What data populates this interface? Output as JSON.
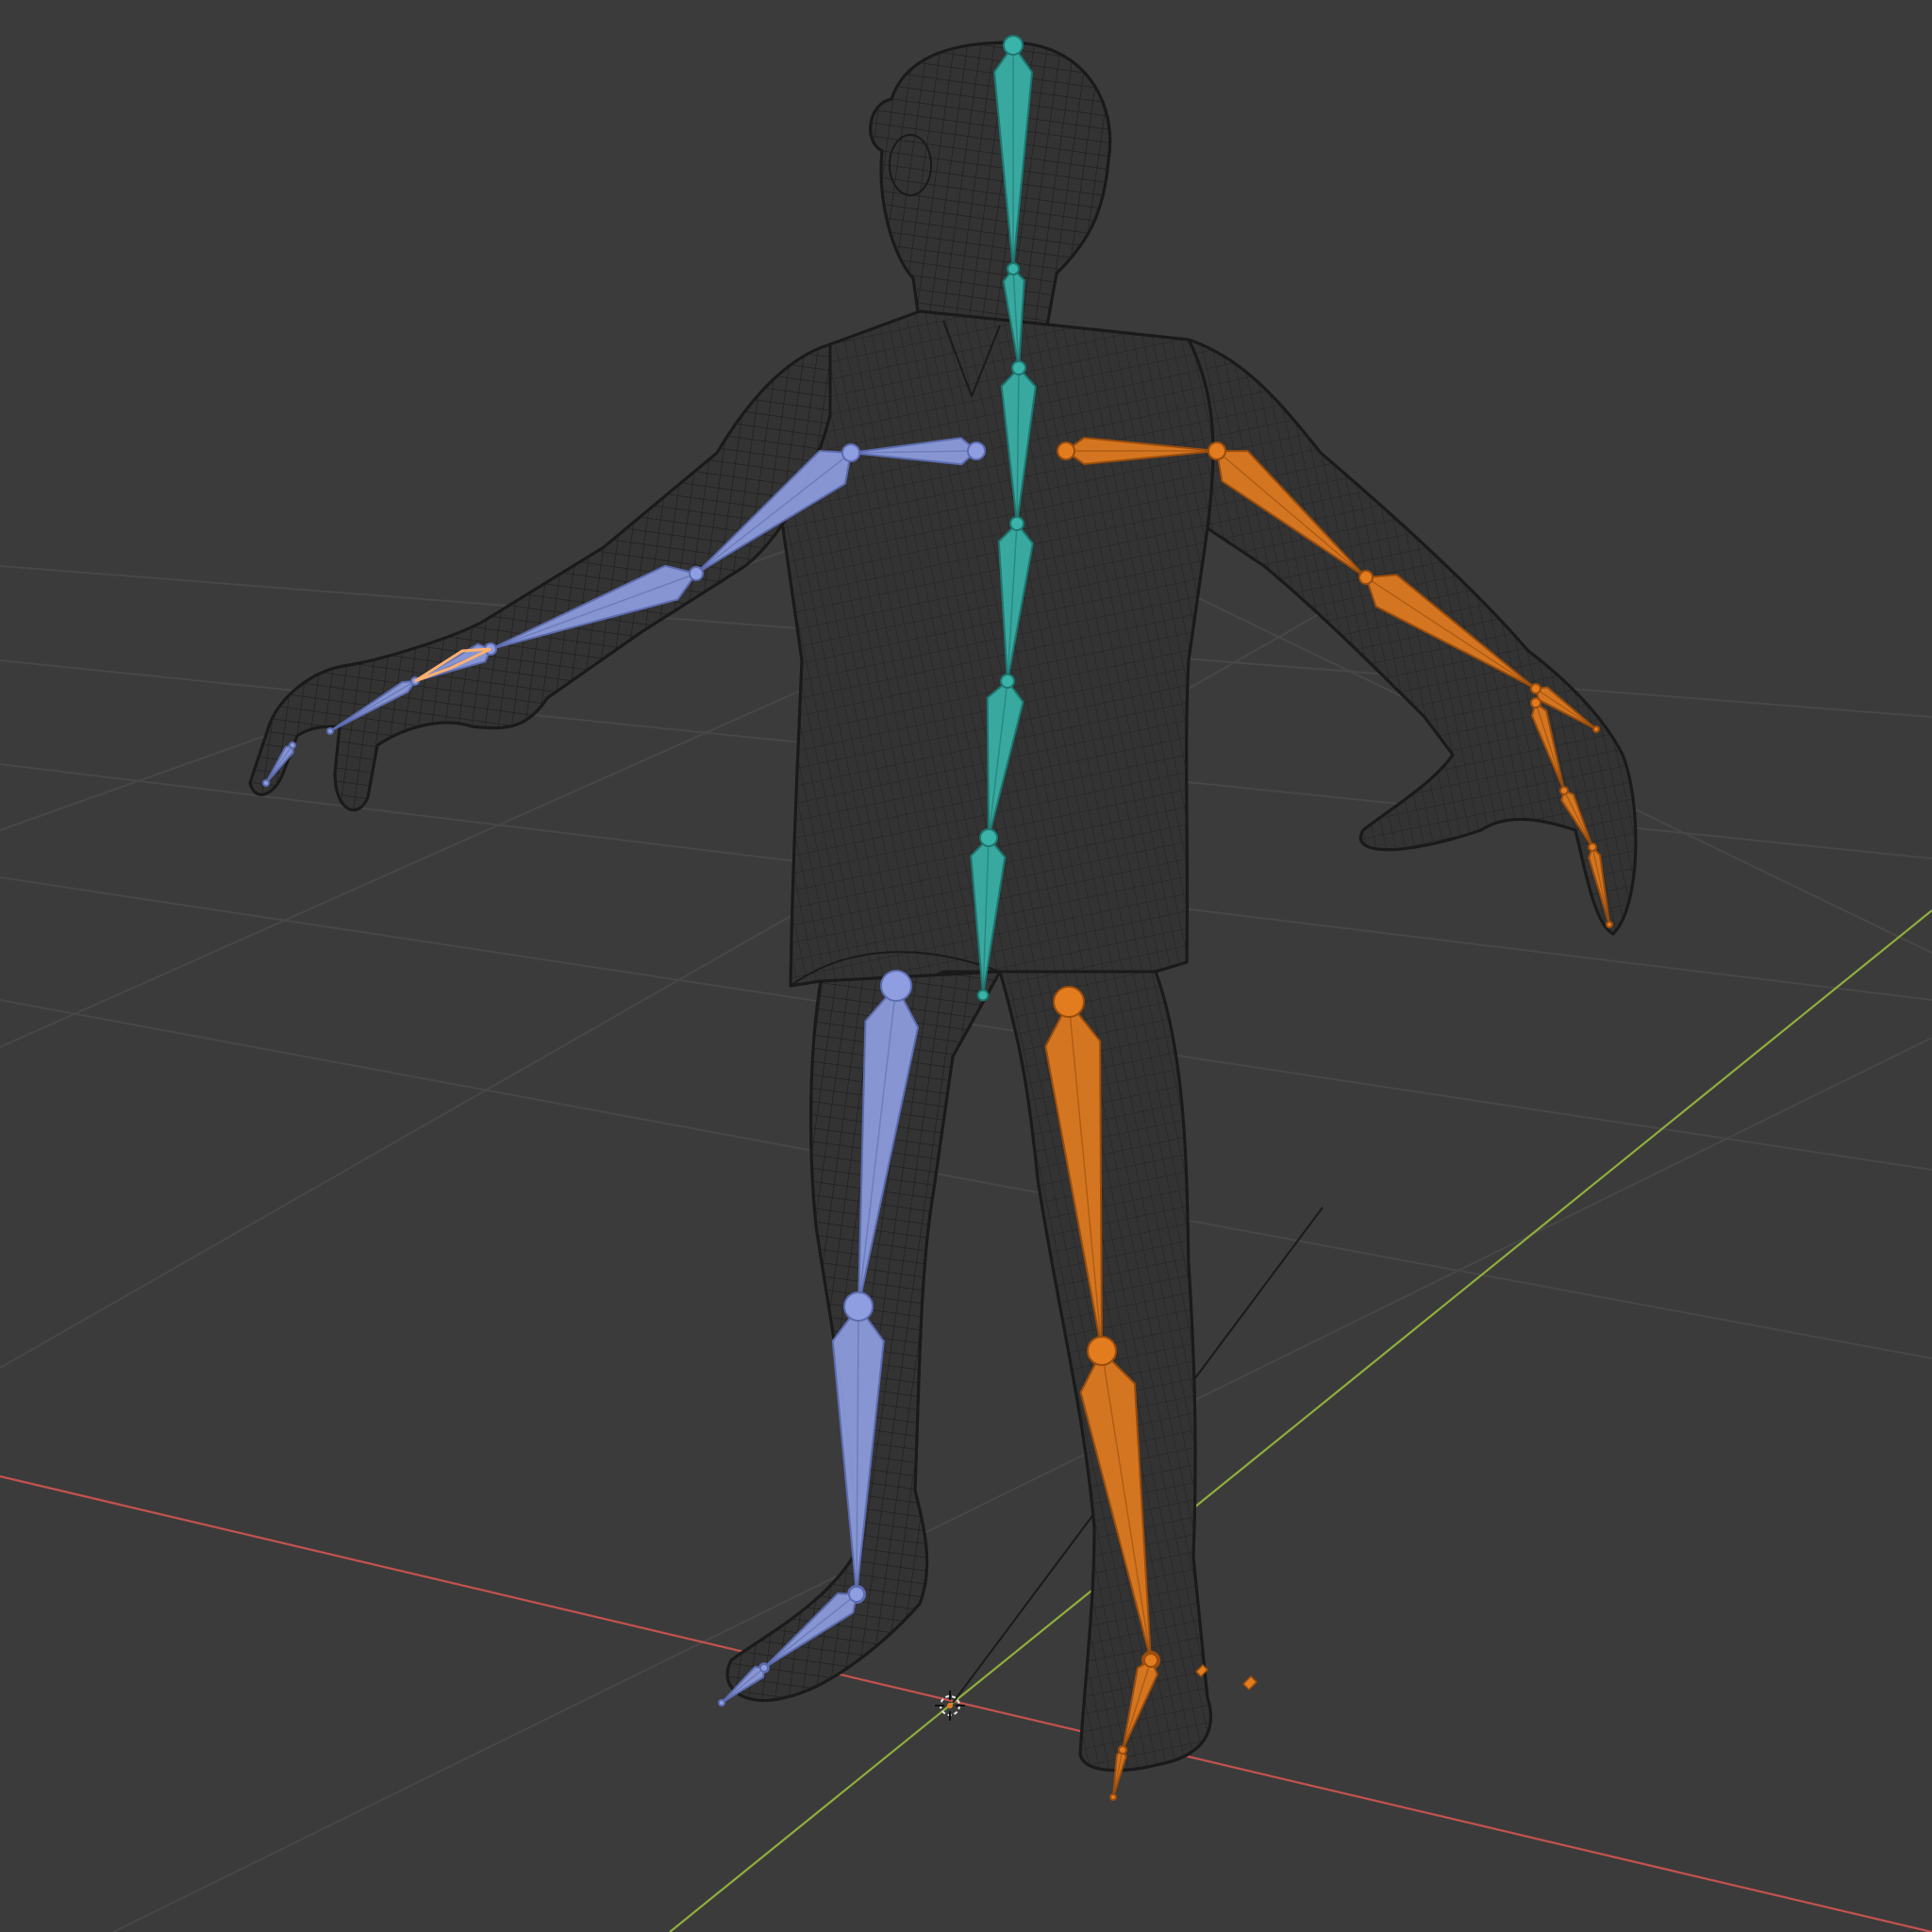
{
  "viewport": {
    "background": "#3b3b3b",
    "grid_color": "#4a4a4a",
    "x_axis_color": "#c4524e",
    "y_axis_color": "#8fae3c",
    "z_axis_color": "#1a1a1a",
    "wireframe_color": "#1c1c1c",
    "mesh_fill": "#343434"
  },
  "armature": {
    "colors": {
      "spine": "#3ab3a9",
      "spine_edge": "#1d7770",
      "left": "#8e9ee0",
      "left_edge": "#5d6cb0",
      "right": "#e27c1f",
      "right_edge": "#9a4c0c",
      "selected_outline": "#ffb070"
    },
    "bone_groups": [
      "spine",
      "left",
      "right"
    ]
  },
  "scene_objects": [
    "character-mesh",
    "armature",
    "3d-cursor"
  ]
}
